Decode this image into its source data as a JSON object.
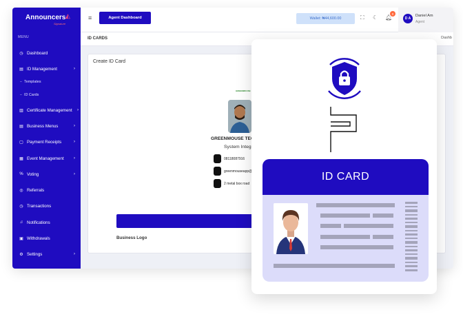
{
  "app": {
    "brand": "Announcers",
    "brand_sub": "Signature",
    "menu_caption": "MENU",
    "sidebar": {
      "items": [
        {
          "label": "Dashboard",
          "icon": "dashboard-icon",
          "chevron": false
        },
        {
          "label": "ID Management",
          "icon": "id-card-icon",
          "chevron": true
        },
        {
          "label": "Certificate Management",
          "icon": "certificate-icon",
          "chevron": true
        },
        {
          "label": "Business Menus",
          "icon": "menu-book-icon",
          "chevron": true
        },
        {
          "label": "Payment Receipts",
          "icon": "receipt-icon",
          "chevron": true
        },
        {
          "label": "Event Management",
          "icon": "calendar-icon",
          "chevron": true
        },
        {
          "label": "Voting",
          "icon": "percent-icon",
          "chevron": true
        },
        {
          "label": "Referrals",
          "icon": "referral-icon",
          "chevron": false
        },
        {
          "label": "Transactions",
          "icon": "transactions-icon",
          "chevron": false
        },
        {
          "label": "Notifications",
          "icon": "bell-icon",
          "chevron": false
        },
        {
          "label": "Withdrawals",
          "icon": "withdrawal-icon",
          "chevron": false
        },
        {
          "label": "Settings",
          "icon": "gear-icon",
          "chevron": true
        }
      ],
      "sub_items": [
        "Templates",
        "ID Cards"
      ]
    },
    "topbar": {
      "agent_button": "Agent Dashboard",
      "wallet": "Wallet: ₦44,600.00",
      "notification_count": "0",
      "user_initials": "D A",
      "user_name": "Daniel Am",
      "user_role": "Agent"
    },
    "page": {
      "title": "ID CARDS",
      "right_text": "Dashb",
      "card_title": "Create ID Card",
      "mini_logo": "GREENMOUSE",
      "holder_name": "GREENMOUSE TECHI",
      "holder_role": "System Integra",
      "phone": "08118087916",
      "email": "greenmouseapp@",
      "address": "2 metal box road",
      "business_logo_label": "Business Logo"
    }
  },
  "panel": {
    "card_heading": "ID CARD",
    "icons": [
      "shield-lock-icon",
      "circuit-line-icon",
      "person-avatar-icon",
      "barcode-icon"
    ]
  },
  "colors": {
    "brand_blue": "#1f0cc0",
    "card_lilac": "#dcdcfa",
    "wallet_bg": "#cfe1fa",
    "badge_orange": "#ff6a3d"
  }
}
